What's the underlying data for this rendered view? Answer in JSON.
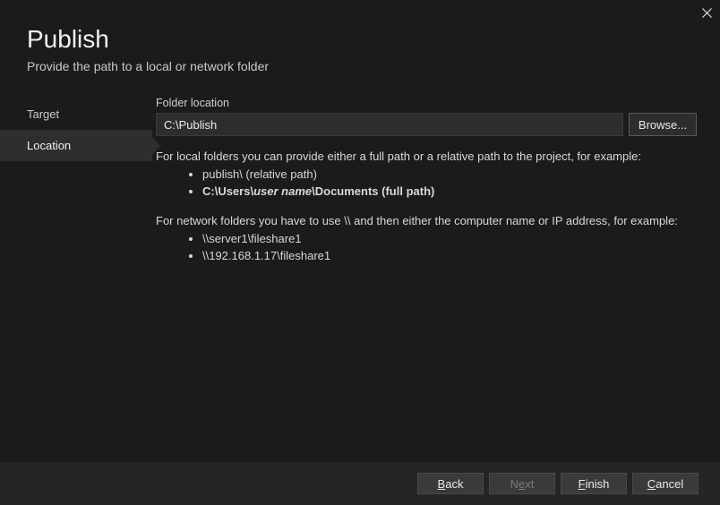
{
  "window": {
    "title": "Publish",
    "subtitle": "Provide the path to a local or network folder"
  },
  "sidebar": {
    "steps": [
      {
        "label": "Target"
      },
      {
        "label": "Location"
      }
    ]
  },
  "content": {
    "folder_location_label": "Folder location",
    "folder_location_value": "C:\\Publish",
    "browse_label": "Browse...",
    "help": {
      "local_intro": "For local folders you can provide either a full path or a relative path to the project, for example:",
      "example_relative": "publish\\ (relative path)",
      "example_full_prefix": "C:\\Users\\",
      "example_full_user": "user name",
      "example_full_suffix": "\\Documents (full path)",
      "network_intro": "For network folders you have to use \\\\ and then either the computer name or IP address, for example:",
      "example_net1": "\\\\server1\\fileshare1",
      "example_net2": "\\\\192.168.1.17\\fileshare1"
    }
  },
  "footer": {
    "back": "Back",
    "next": "Next",
    "finish": "Finish",
    "cancel": "Cancel"
  }
}
